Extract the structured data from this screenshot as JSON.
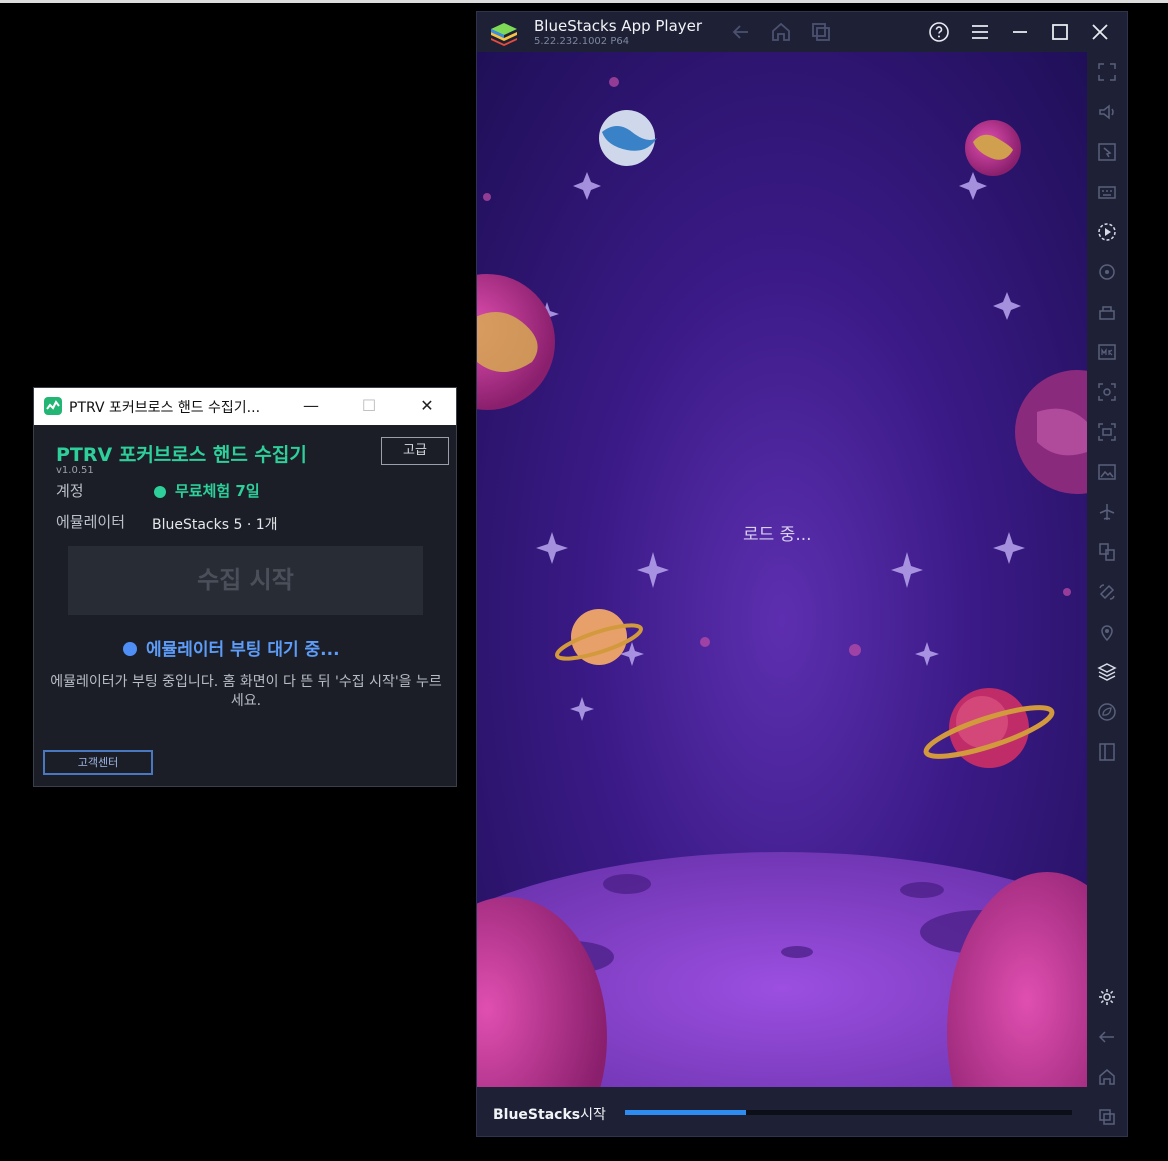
{
  "ptrv": {
    "window_title": "PTRV 포커브로스 핸드 수집기...",
    "minimize_glyph": "—",
    "maximize_glyph": "☐",
    "close_glyph": "✕",
    "app_title": "PTRV 포커브로스 핸드 수집기",
    "version": "v1.0.51",
    "advanced_label": "고급",
    "account_label": "계정",
    "account_value": "무료체험 7일",
    "emulator_label": "에뮬레이터",
    "emulator_value": "BlueStacks 5 · 1개",
    "start_label": "수집 시작",
    "status_text": "에뮬레이터 부팅 대기 중...",
    "description": "에뮬레이터가 부팅 중입니다. 홈 화면이 다 뜬 뒤 '수집 시작'을 누르세요.",
    "support_label": "고객센터",
    "colors": {
      "accent": "#2ecf9a",
      "status": "#5d9cf8"
    }
  },
  "bluestacks": {
    "title": "BlueStacks App Player",
    "version": "5.22.232.1002  P64",
    "loading_text": "로드 중...",
    "bottom_brand": "BlueStacks",
    "bottom_action": "시작",
    "progress": 0.27,
    "titlebar_icons": [
      "back-icon",
      "home-icon",
      "recent-apps-icon",
      "help-icon",
      "menu-icon",
      "minimize-icon",
      "maximize-icon",
      "close-icon"
    ],
    "sidebar_icons": [
      "fullscreen-icon",
      "volume-icon",
      "pointer-icon",
      "keyboard-icon",
      "macro-play-icon",
      "sync-icon",
      "multi-instance-icon",
      "apk-icon",
      "screenshot-icon",
      "record-icon",
      "gallery-icon",
      "airplane-icon",
      "multi-window-icon",
      "rotate-icon",
      "location-icon",
      "layers-icon",
      "eco-mode-icon",
      "sidebar-toggle-icon",
      "settings-icon",
      "android-back-icon",
      "android-home-icon",
      "android-recent-icon"
    ],
    "colors": {
      "progress": "#2e8cf0",
      "chrome": "#1e2135"
    }
  }
}
